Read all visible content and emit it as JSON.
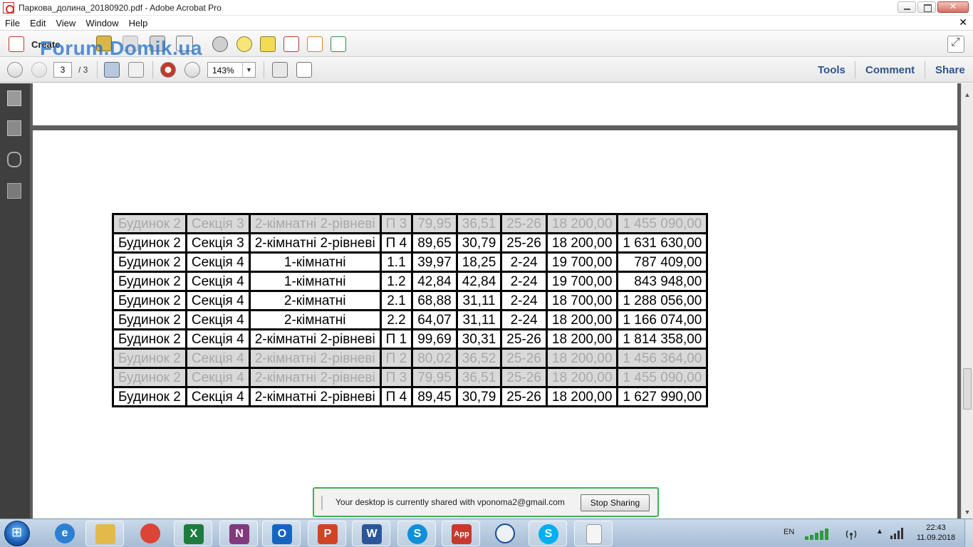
{
  "window": {
    "title": "Паркова_долина_20180920.pdf - Adobe Acrobat Pro",
    "menu": [
      "File",
      "Edit",
      "View",
      "Window",
      "Help"
    ]
  },
  "toolbar": {
    "create_label": "Create",
    "watermark": "Forum.Domik.ua"
  },
  "navigation": {
    "current_page": "3",
    "total_pages": "/ 3",
    "zoom": "143%",
    "links": [
      "Tools",
      "Comment",
      "Share"
    ]
  },
  "table": {
    "rows": [
      {
        "dim": true,
        "cells": [
          "Будинок 2",
          "Секція 3",
          "2-кімнатні 2-рівневі",
          "П 3",
          "79,95",
          "36,51",
          "25-26",
          "18 200,00",
          "1 455 090,00"
        ]
      },
      {
        "dim": false,
        "cells": [
          "Будинок 2",
          "Секція 3",
          "2-кімнатні 2-рівневі",
          "П 4",
          "89,65",
          "30,79",
          "25-26",
          "18 200,00",
          "1 631 630,00"
        ]
      },
      {
        "dim": false,
        "cells": [
          "Будинок 2",
          "Секція 4",
          "1-кімнатні",
          "1.1",
          "39,97",
          "18,25",
          "2-24",
          "19 700,00",
          "787 409,00"
        ]
      },
      {
        "dim": false,
        "cells": [
          "Будинок 2",
          "Секція 4",
          "1-кімнатні",
          "1.2",
          "42,84",
          "42,84",
          "2-24",
          "19 700,00",
          "843 948,00"
        ]
      },
      {
        "dim": false,
        "cells": [
          "Будинок 2",
          "Секція 4",
          "2-кімнатні",
          "2.1",
          "68,88",
          "31,11",
          "2-24",
          "18 700,00",
          "1 288 056,00"
        ]
      },
      {
        "dim": false,
        "cells": [
          "Будинок 2",
          "Секція 4",
          "2-кімнатні",
          "2.2",
          "64,07",
          "31,11",
          "2-24",
          "18 200,00",
          "1 166 074,00"
        ]
      },
      {
        "dim": false,
        "cells": [
          "Будинок 2",
          "Секція 4",
          "2-кімнатні 2-рівневі",
          "П 1",
          "99,69",
          "30,31",
          "25-26",
          "18 200,00",
          "1 814 358,00"
        ]
      },
      {
        "dim": true,
        "cells": [
          "Будинок 2",
          "Секція 4",
          "2-кімнатні 2-рівневі",
          "П 2",
          "80,02",
          "36,52",
          "25-26",
          "18 200,00",
          "1 456 364,00"
        ]
      },
      {
        "dim": true,
        "cells": [
          "Будинок 2",
          "Секція 4",
          "2-кімнатні 2-рівневі",
          "П 3",
          "79,95",
          "36,51",
          "25-26",
          "18 200,00",
          "1 455 090,00"
        ]
      },
      {
        "dim": false,
        "cells": [
          "Будинок 2",
          "Секція 4",
          "2-кімнатні 2-рівневі",
          "П 4",
          "89,45",
          "30,79",
          "25-26",
          "18 200,00",
          "1 627 990,00"
        ]
      }
    ]
  },
  "share_banner": {
    "text": "Your desktop is currently shared with vponoma2@gmail.com",
    "button": "Stop Sharing"
  },
  "taskbar": {
    "items": [
      {
        "name": "internet-explorer",
        "glyph": "e",
        "color": "#2f7fd1"
      },
      {
        "name": "file-explorer",
        "glyph": "",
        "color": "#e3b94a"
      },
      {
        "name": "chrome",
        "glyph": "",
        "color": "#db4437"
      },
      {
        "name": "excel",
        "glyph": "X",
        "color": "#1f7a3e"
      },
      {
        "name": "onenote",
        "glyph": "N",
        "color": "#80397b"
      },
      {
        "name": "outlook",
        "glyph": "O",
        "color": "#1565c0"
      },
      {
        "name": "powerpoint",
        "glyph": "P",
        "color": "#d04423"
      },
      {
        "name": "word",
        "glyph": "W",
        "color": "#2b579a"
      },
      {
        "name": "skype-business",
        "glyph": "S",
        "color": "#0f8fd6"
      },
      {
        "name": "app",
        "glyph": "App",
        "color": "#c8382f"
      },
      {
        "name": "robot-app",
        "glyph": "",
        "color": "#eef1f5"
      },
      {
        "name": "skype",
        "glyph": "S",
        "color": "#00aff0"
      },
      {
        "name": "blank-document",
        "glyph": "",
        "color": "#f5f5f5"
      }
    ],
    "language": "EN",
    "time": "22:43",
    "date": "11.09.2018"
  }
}
